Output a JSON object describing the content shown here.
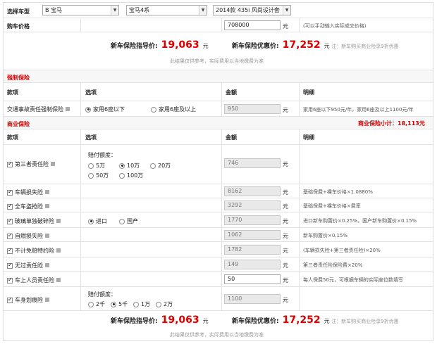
{
  "selector": {
    "label": "选择车型",
    "brand": "B 宝马",
    "series": "宝马4系",
    "model": "2014款 435i 风尚设计套"
  },
  "purchase": {
    "label": "购车价格",
    "value": "708000",
    "unit": "元",
    "note": "(可以手动输入实际成交价格)"
  },
  "summary": {
    "guide_label": "新车保险指导价:",
    "guide_value": "19,063",
    "unit": "元",
    "discount_label": "新车保险优惠价:",
    "discount_value": "17,252",
    "discount_note": "注：新车购买商业险享9折优惠",
    "disclaimer": "此结果仅供参考，实际费用以当地缴费为准"
  },
  "compulsory": {
    "title": "强制保险",
    "headers": [
      "款项",
      "选项",
      "金额",
      "明细"
    ],
    "item": "交通事故责任强制保险",
    "options": [
      "家用6座以下",
      "家用6座及以上"
    ],
    "amount": "950",
    "unit": "元",
    "detail": "家用6座以下950元/年，家用6座及以上1100元/年"
  },
  "commercial": {
    "title": "商业保险",
    "subtotal_label": "商业保险小计：",
    "subtotal_value": "18,113元",
    "headers": [
      "款项",
      "选项",
      "金额",
      "明细"
    ],
    "third_party": {
      "item": "第三者责任险",
      "limit_label": "赔付额度：",
      "options": [
        "5万",
        "10万",
        "20万",
        "50万",
        "100万"
      ],
      "amount": "746",
      "unit": "元"
    },
    "vehicle_damage": {
      "item": "车辆损失险",
      "amount": "8162",
      "unit": "元",
      "detail": "基础保费+裸车价格×1.0880%"
    },
    "theft": {
      "item": "全车盗抢险",
      "amount": "3292",
      "unit": "元",
      "detail": "基础保费+裸车价格×费率"
    },
    "glass": {
      "item": "玻璃单独破碎险",
      "options": [
        "进口",
        "国产"
      ],
      "amount": "1770",
      "unit": "元",
      "detail": "进口新车购置价×0.25%，国产新车购置价×0.15%"
    },
    "self_ignition": {
      "item": "自燃损失险",
      "amount": "1062",
      "unit": "元",
      "detail": "新车购置价×0.15%"
    },
    "deductible": {
      "item": "不计免赔特约险",
      "amount": "1782",
      "unit": "元",
      "detail": "(车辆损失险+第三者责任险)×20%"
    },
    "no_fault": {
      "item": "无过责任险",
      "amount": "149",
      "unit": "元",
      "detail": "第三者责任险保险费×20%"
    },
    "passenger": {
      "item": "车上人员责任险",
      "amount": "50",
      "unit": "元",
      "detail": "每人保费50元，可根据车辆的实际座位数填写"
    },
    "scratch": {
      "item": "车身划痕险",
      "limit_label": "赔付额度：",
      "options": [
        "2千",
        "5千",
        "1万",
        "2万"
      ],
      "amount": "1100",
      "unit": "元"
    }
  }
}
